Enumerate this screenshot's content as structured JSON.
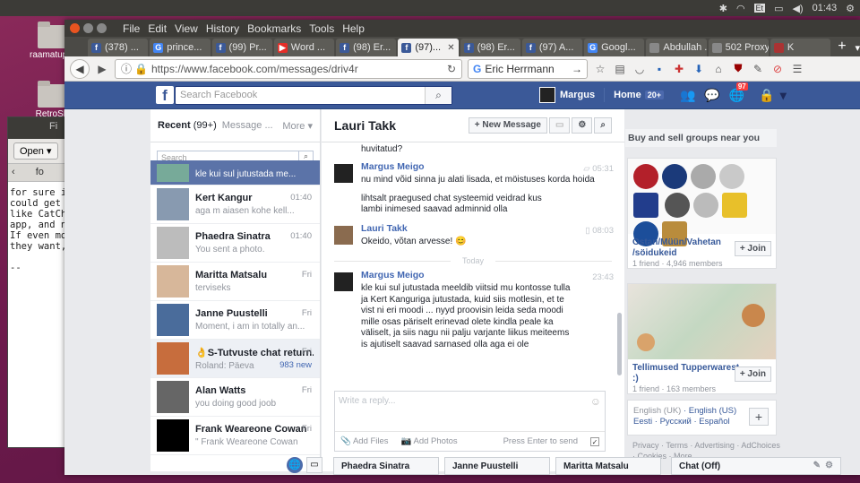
{
  "desktop": {
    "icons": [
      {
        "label": "raamatupid"
      },
      {
        "label": "RetroSh"
      }
    ]
  },
  "topbar": {
    "time": "01:43",
    "keyboard": "Et"
  },
  "gedit": {
    "title": "Fi",
    "open_label": "Open",
    "tab_label": "fo",
    "text": "for sure i\ncould get\nlike CatCh\napp, and n\nIf even mo\nthey want,\n\n--"
  },
  "firefox": {
    "menu": [
      "File",
      "Edit",
      "View",
      "History",
      "Bookmarks",
      "Tools",
      "Help"
    ],
    "tabs": [
      {
        "label": "(378) ...",
        "fav": "f",
        "color": "#3b5998"
      },
      {
        "label": "prince...",
        "fav": "G",
        "color": "#4285f4"
      },
      {
        "label": "(99) Pr...",
        "fav": "f",
        "color": "#3b5998"
      },
      {
        "label": "Word ...",
        "fav": "▶",
        "color": "#e52d27"
      },
      {
        "label": "(98) Er...",
        "fav": "f",
        "color": "#3b5998"
      },
      {
        "label": "(97)...",
        "fav": "f",
        "color": "#3b5998",
        "active": true
      },
      {
        "label": "(98) Er...",
        "fav": "f",
        "color": "#3b5998"
      },
      {
        "label": "(97) A...",
        "fav": "f",
        "color": "#3b5998"
      },
      {
        "label": "Googl...",
        "fav": "G",
        "color": "#4285f4"
      },
      {
        "label": "Abdullah ...",
        "fav": "",
        "color": "#888"
      },
      {
        "label": "502 Proxy...",
        "fav": "",
        "color": "#888"
      },
      {
        "label": "K",
        "fav": "",
        "color": "#a33"
      }
    ],
    "url": "https://www.facebook.com/messages/driv4r",
    "search_value": "Eric Herrmann"
  },
  "facebook": {
    "search_placeholder": "Search Facebook",
    "user_name": "Margus",
    "home_label": "Home",
    "home_count": "20+",
    "notif_count": "97",
    "left": {
      "recent_label": "Recent",
      "recent_count": "(99+)",
      "message_requests": "Message ...",
      "more": "More ▾",
      "search_placeholder": "Search",
      "conversations": [
        {
          "name": "",
          "snippet": "kle kui sul jutustada me...",
          "time": "",
          "selected": true,
          "color": "#7a9"
        },
        {
          "name": "Kert Kangur",
          "snippet": "aga m aiasen kohe kell...",
          "time": "01:40",
          "color": "#889ab0"
        },
        {
          "name": "Phaedra Sinatra",
          "snippet": "You sent a photo.",
          "time": "01:40",
          "color": "#bcbcbc"
        },
        {
          "name": "Maritta Matsalu",
          "snippet": "terviseks",
          "time": "Fri",
          "color": "#d7b79a"
        },
        {
          "name": "Janne Puustelli",
          "snippet": "Moment, i am in totally an...",
          "time": "Fri",
          "color": "#4a6c9b"
        },
        {
          "name": "👌S-Tutvuste chat return...",
          "snippet": "Roland: Päeva",
          "time": "Fri",
          "new": "983 new",
          "highlight": true,
          "color": "#c76d3d"
        },
        {
          "name": "Alan Watts",
          "snippet": "you doing good joob",
          "time": "Fri",
          "color": "#666"
        },
        {
          "name": "Frank Weareone Cowan",
          "snippet": "\" Frank Weareone Cowan",
          "time": "Fri",
          "color": "#000"
        }
      ]
    },
    "mid": {
      "title": "Lauri Takk",
      "new_message": "+ New Message",
      "first_line": "huvitatud?",
      "messages": [
        {
          "sender": "Margus Meigo",
          "time": "05:31",
          "text": "nu mind võid sinna ju alati lisada, et möistuses korda hoida"
        },
        {
          "sender": "",
          "time": "",
          "text": "lihtsalt praegused chat systeemid veidrad kus lambi inimesed saavad adminnid olla"
        },
        {
          "sender": "Lauri Takk",
          "time": "08:03",
          "text": "Okeido, võtan arvesse! 😊"
        },
        {
          "sender": "Margus Meigo",
          "time": "23:43",
          "text": "kle kui sul jutustada meeldib viitsid mu kontosse tulla ja Kert Kanguriga jutustada, kuid siis motlesin, et te vist ni eri moodi ... nyyd proovisin leida seda moodi mille osas päriselt erinevad olete kindla peale ka väliselt, ja siis nagu nii palju varjante liikus meiteems is ajutiselt saavad sarnased olla aga ei ole"
        }
      ],
      "today_label": "Today",
      "reply_placeholder": "Write a reply...",
      "add_files": "Add Files",
      "add_photos": "Add Photos",
      "press_enter": "Press Enter to send"
    },
    "right": {
      "section_title": "Buy and sell groups near you",
      "groups": [
        {
          "name": "Ostan/Müün/Vahetan /söidukeid",
          "meta": "1 friend · 4,946 members",
          "join": "+ Join"
        },
        {
          "name": "Tellimused Tupperwarest :)",
          "meta": "1 friend · 163 members",
          "join": "+ Join"
        }
      ],
      "languages": [
        "English (UK)",
        "English (US)",
        "Eesti",
        "Русский",
        "Español"
      ],
      "footer": "Privacy · Terms · Advertising · AdChoices · Cookies · More"
    },
    "chat_tabs": [
      "Phaedra Sinatra",
      "Janne Puustelli",
      "Maritta Matsalu"
    ],
    "chat_off": "Chat (Off)"
  }
}
